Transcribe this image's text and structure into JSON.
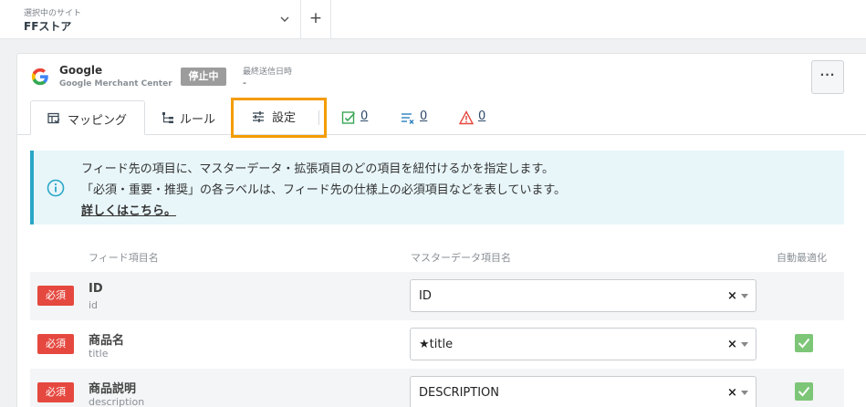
{
  "site_selector": {
    "caption": "選択中のサイト",
    "name": "FFストア",
    "add_label": "+"
  },
  "service": {
    "name": "Google",
    "sub": "Google Merchant Center",
    "status": "停止中",
    "last_sent_label": "最終送信日時",
    "last_sent_value": "-",
    "more_label": "···"
  },
  "tabs": {
    "mapping": "マッピング",
    "rule": "ルール",
    "settings": "設定",
    "ok_count": "0",
    "error_count": "0",
    "warning_count": "0"
  },
  "info": {
    "line1": "フィード先の項目に、マスターデータ・拡張項目のどの項目を紐付けるかを指定します。",
    "line2": "「必須・重要・推奨」の各ラベルは、フィード先の仕様上の必須項目などを表しています。",
    "link": "詳しくはこちら。"
  },
  "table": {
    "headers": {
      "feed": "フィード項目名",
      "master": "マスターデータ項目名",
      "auto": "自動最適化"
    },
    "rows": [
      {
        "badge": "必須",
        "name": "ID",
        "key": "id",
        "value": "ID",
        "clear": "×",
        "auto": false
      },
      {
        "badge": "必須",
        "name": "商品名",
        "key": "title",
        "value": "★title",
        "clear": "×",
        "auto": true
      },
      {
        "badge": "必須",
        "name": "商品説明",
        "key": "description",
        "value": "DESCRIPTION",
        "clear": "×",
        "auto": true
      }
    ]
  },
  "colors": {
    "accent_highlight": "#f49c00",
    "required_badge": "#e5483f",
    "status_badge": "#9c9c9c",
    "info_border": "#2aa7c6",
    "check": "#7dc678"
  }
}
